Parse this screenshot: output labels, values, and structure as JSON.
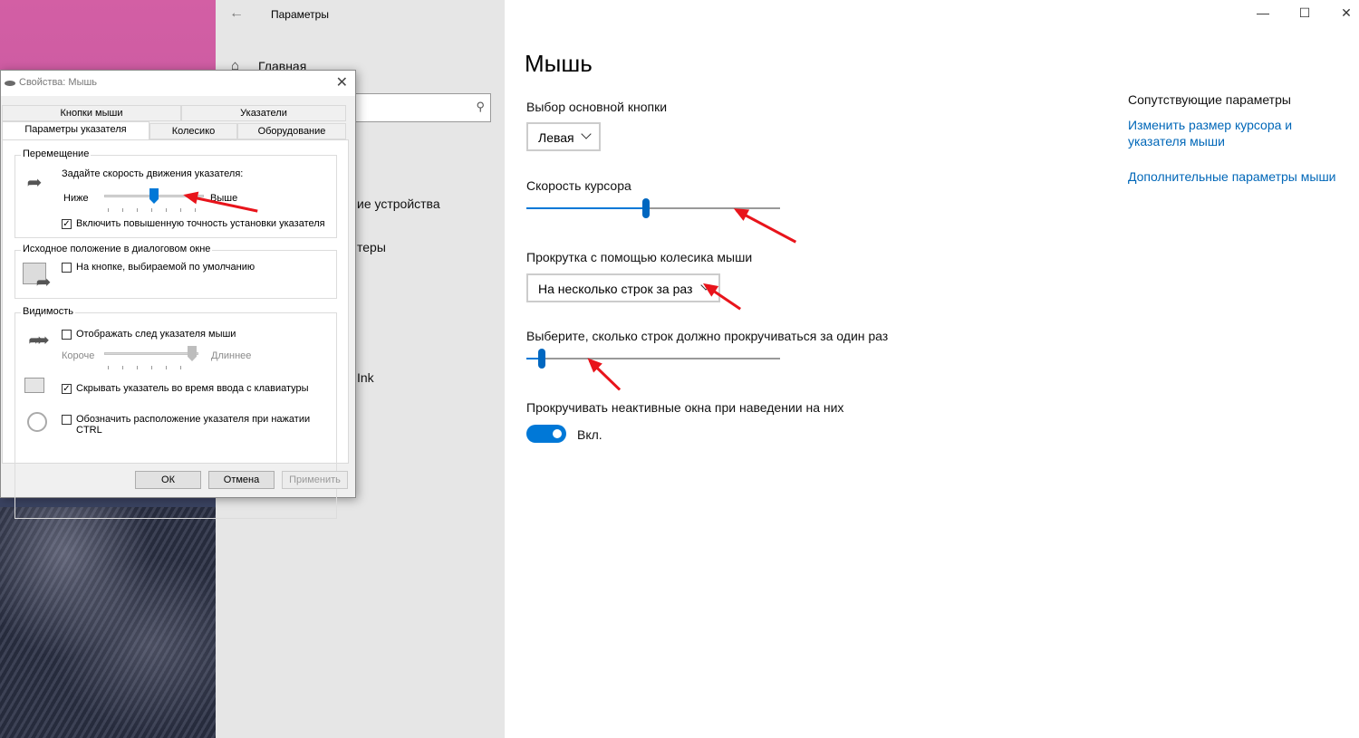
{
  "settings": {
    "app_title": "Параметры",
    "nav": {
      "home": "Главная",
      "item_devices_partial": "ие устройства",
      "item_printers_partial": "теры",
      "item_ink_partial": "Ink"
    },
    "page_title": "Мышь",
    "primary_button": {
      "label": "Выбор основной кнопки",
      "value": "Левая"
    },
    "cursor_speed": {
      "label": "Скорость курсора",
      "value_fraction": 0.47
    },
    "wheel_scroll": {
      "label": "Прокрутка с помощью колесика мыши",
      "value": "На несколько строк за раз"
    },
    "lines_per_scroll": {
      "label": "Выберите, сколько строк должно прокручиваться за один раз",
      "value_fraction": 0.06
    },
    "inactive_scroll": {
      "label": "Прокручивать неактивные окна при наведении на них",
      "state": "Вкл."
    },
    "related": {
      "title": "Сопутствующие параметры",
      "link1_line1": "Изменить размер курсора и",
      "link1_line2": "указателя мыши",
      "link2": "Дополнительные параметры мыши"
    },
    "accent_color": "#0078d7"
  },
  "dialog": {
    "title": "Свойства: Мышь",
    "tabs_row1": [
      "Кнопки мыши",
      "Указатели"
    ],
    "tabs_row2": [
      "Параметры указателя",
      "Колесико",
      "Оборудование"
    ],
    "motion": {
      "group": "Перемещение",
      "prompt": "Задайте скорость движения указателя:",
      "slower": "Ниже",
      "faster": "Выше",
      "speed_fraction": 0.5,
      "precision_label": "Включить повышенную точность установки указателя",
      "precision_checked": true
    },
    "snap": {
      "group": "Исходное положение в диалоговом окне",
      "label": "На кнопке, выбираемой по умолчанию",
      "checked": false
    },
    "visibility": {
      "group": "Видимость",
      "trails_label": "Отображать след указателя мыши",
      "trails_checked": false,
      "short": "Короче",
      "long": "Длиннее",
      "hide_label": "Скрывать указатель во время ввода с клавиатуры",
      "hide_checked": true,
      "ctrl_label_line1": "Обозначить расположение указателя при нажатии",
      "ctrl_label_line2": "CTRL",
      "ctrl_checked": false
    },
    "buttons": {
      "ok": "ОК",
      "cancel": "Отмена",
      "apply": "Применить"
    }
  }
}
